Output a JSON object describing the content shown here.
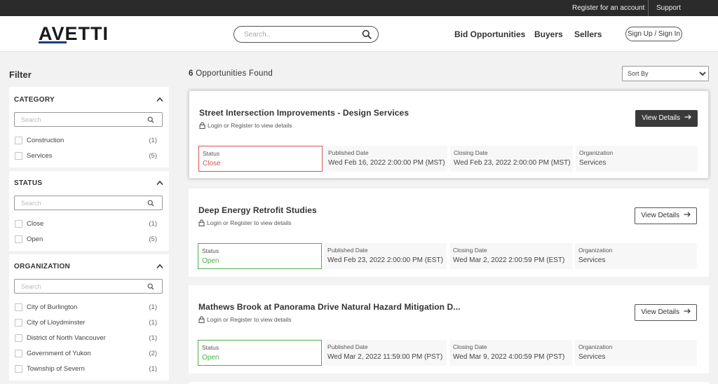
{
  "topbar": {
    "register": "Register for an account",
    "support": "Support"
  },
  "header": {
    "logo": "AVETTI",
    "search_placeholder": "Search..",
    "nav": [
      "Bid Opportunities",
      "Buyers",
      "Sellers"
    ],
    "signin": "Sign Up / Sign In"
  },
  "sidebar": {
    "title": "Filter",
    "category": {
      "title": "CATEGORY",
      "search_placeholder": "Search",
      "items": [
        {
          "label": "Construction",
          "count": "(1)"
        },
        {
          "label": "Services",
          "count": "(5)"
        }
      ]
    },
    "status": {
      "title": "STATUS",
      "search_placeholder": "Search",
      "items": [
        {
          "label": "Close",
          "count": "(1)"
        },
        {
          "label": "Open",
          "count": "(5)"
        }
      ]
    },
    "organization": {
      "title": "ORGANIZATION",
      "search_placeholder": "Search",
      "items": [
        {
          "label": "City of Burlington",
          "count": "(1)"
        },
        {
          "label": "City of Lloydminster",
          "count": "(1)"
        },
        {
          "label": "District of North Vancouver",
          "count": "(1)"
        },
        {
          "label": "Government of Yukon",
          "count": "(2)"
        },
        {
          "label": "Township of Severn",
          "count": "(1)"
        }
      ]
    }
  },
  "main": {
    "count_number": "6",
    "count_text": "Opportunities Found",
    "sort_label": "Sort By",
    "login_text": "Login or Register to view details",
    "view_details": "View Details",
    "labels": {
      "status": "Status",
      "published": "Published Date",
      "closing": "Closing Date",
      "organization": "Organization"
    },
    "cards": [
      {
        "title": "Street Intersection Improvements - Design Services",
        "status": "Close",
        "published": "Wed Feb 16, 2022 2:00:00 PM (MST)",
        "closing": "Wed Feb 23, 2022 2:00:00 PM (MST)",
        "organization": "Services"
      },
      {
        "title": "Deep Energy Retrofit Studies",
        "status": "Open",
        "published": "Wed Feb 23, 2022 2:00:00 PM (EST)",
        "closing": "Wed Mar 2, 2022 2:00:59 PM (EST)",
        "organization": "Services"
      },
      {
        "title": "Mathews Brook at Panorama Drive Natural Hazard Mitigation D...",
        "status": "Open",
        "published": "Wed Mar 2, 2022 11:59:00 PM (PST)",
        "closing": "Wed Mar 9, 2022 4:00:59 PM (PST)",
        "organization": "Services"
      }
    ]
  },
  "colors": {
    "close": "#d9534f",
    "open": "#4cae4c",
    "topbar": "#2b2b2b",
    "logo_accent": "#1f3b7a"
  }
}
